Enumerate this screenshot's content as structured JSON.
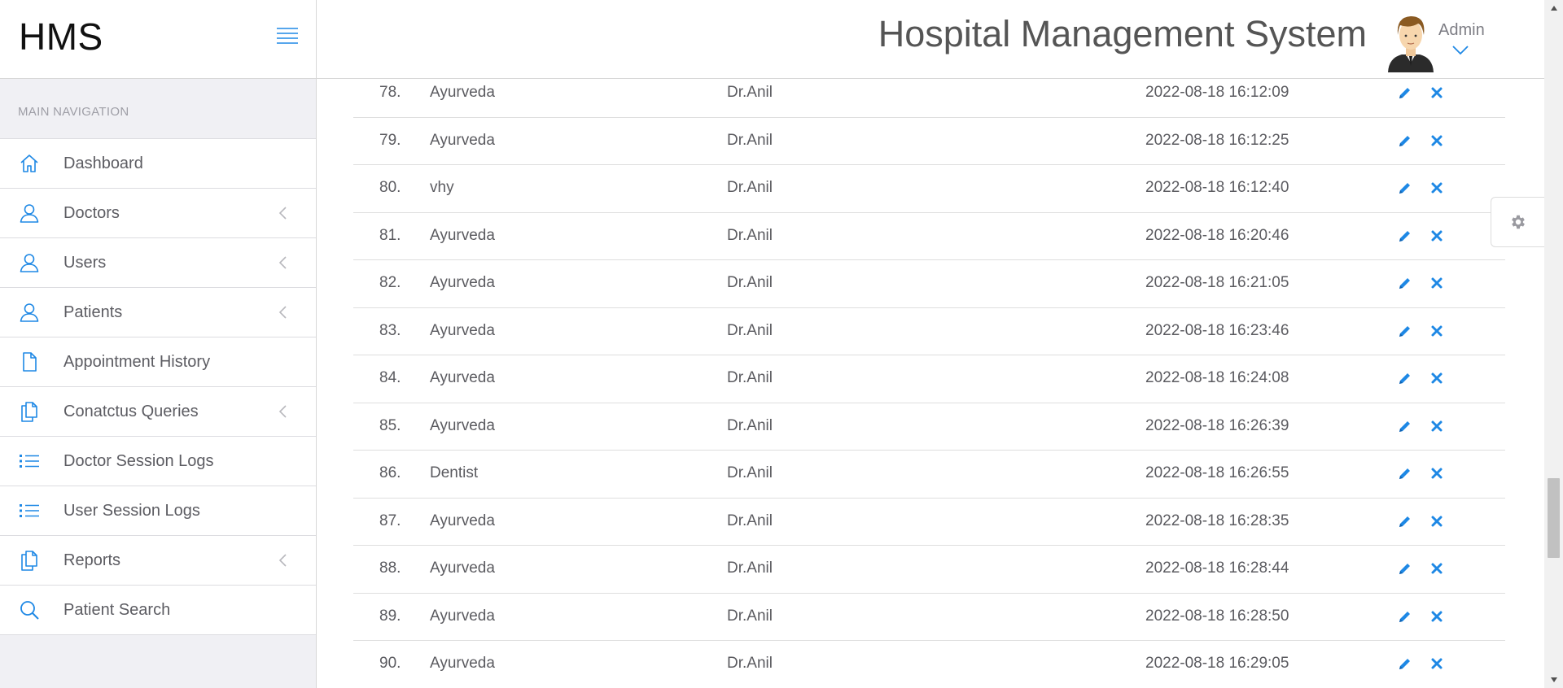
{
  "brand": {
    "name": "HMS"
  },
  "header": {
    "title": "Hospital Management System",
    "user": "Admin"
  },
  "sidebar": {
    "heading": "MAIN NAVIGATION",
    "items": [
      {
        "label": "Dashboard",
        "icon": "home-icon",
        "submenu": false
      },
      {
        "label": "Doctors",
        "icon": "user-icon",
        "submenu": true
      },
      {
        "label": "Users",
        "icon": "user-icon",
        "submenu": true
      },
      {
        "label": "Patients",
        "icon": "user-icon",
        "submenu": true
      },
      {
        "label": "Appointment History",
        "icon": "file-icon",
        "submenu": false
      },
      {
        "label": "Conatctus Queries",
        "icon": "files-icon",
        "submenu": true
      },
      {
        "label": "Doctor Session Logs",
        "icon": "list-icon",
        "submenu": false
      },
      {
        "label": "User Session Logs",
        "icon": "list-icon",
        "submenu": false
      },
      {
        "label": "Reports",
        "icon": "files-icon",
        "submenu": true
      },
      {
        "label": "Patient Search",
        "icon": "search-icon",
        "submenu": false
      }
    ]
  },
  "table": {
    "rows": [
      {
        "num": "78.",
        "specialization": "Ayurveda",
        "doctor": "Dr.Anil",
        "date": "2022-08-18 16:12:09"
      },
      {
        "num": "79.",
        "specialization": "Ayurveda",
        "doctor": "Dr.Anil",
        "date": "2022-08-18 16:12:25"
      },
      {
        "num": "80.",
        "specialization": "vhy",
        "doctor": "Dr.Anil",
        "date": "2022-08-18 16:12:40"
      },
      {
        "num": "81.",
        "specialization": "Ayurveda",
        "doctor": "Dr.Anil",
        "date": "2022-08-18 16:20:46"
      },
      {
        "num": "82.",
        "specialization": "Ayurveda",
        "doctor": "Dr.Anil",
        "date": "2022-08-18 16:21:05"
      },
      {
        "num": "83.",
        "specialization": "Ayurveda",
        "doctor": "Dr.Anil",
        "date": "2022-08-18 16:23:46"
      },
      {
        "num": "84.",
        "specialization": "Ayurveda",
        "doctor": "Dr.Anil",
        "date": "2022-08-18 16:24:08"
      },
      {
        "num": "85.",
        "specialization": "Ayurveda",
        "doctor": "Dr.Anil",
        "date": "2022-08-18 16:26:39"
      },
      {
        "num": "86.",
        "specialization": "Dentist",
        "doctor": "Dr.Anil",
        "date": "2022-08-18 16:26:55"
      },
      {
        "num": "87.",
        "specialization": "Ayurveda",
        "doctor": "Dr.Anil",
        "date": "2022-08-18 16:28:35"
      },
      {
        "num": "88.",
        "specialization": "Ayurveda",
        "doctor": "Dr.Anil",
        "date": "2022-08-18 16:28:44"
      },
      {
        "num": "89.",
        "specialization": "Ayurveda",
        "doctor": "Dr.Anil",
        "date": "2022-08-18 16:28:50"
      },
      {
        "num": "90.",
        "specialization": "Ayurveda",
        "doctor": "Dr.Anil",
        "date": "2022-08-18 16:29:05"
      }
    ]
  },
  "colors": {
    "accent": "#1e88e5",
    "text": "#5b5b60",
    "sidebar_bg": "#f0f0f4"
  }
}
